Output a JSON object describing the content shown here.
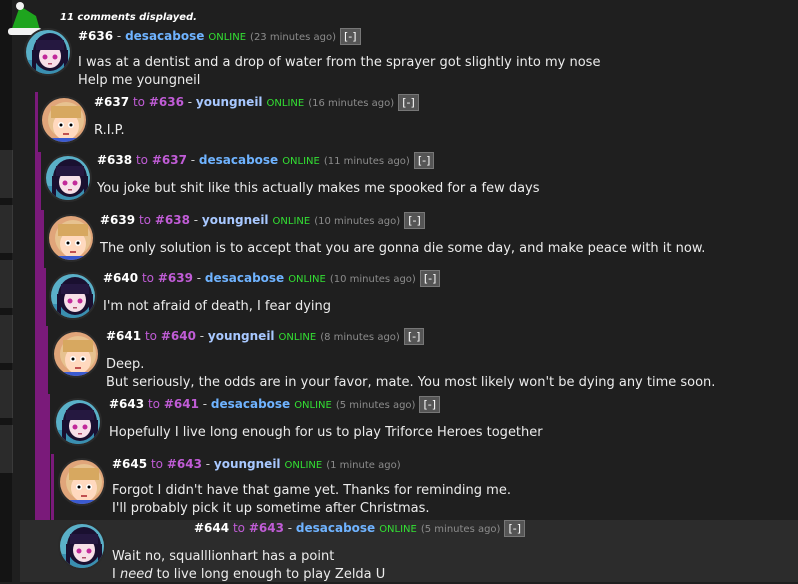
{
  "header": {
    "comments_displayed": "11 comments displayed."
  },
  "colors": {
    "thread_line": "#7a1a7a",
    "online": "#33e033",
    "reply_link": "#c05cd6",
    "desacabose": "#6fb3ff",
    "youngneil": "#a8c8ff"
  },
  "comments": [
    {
      "id": "#636",
      "reply_to": "",
      "user": "desacabose",
      "status": "ONLINE",
      "time": "(23 minutes ago)",
      "collapse": "[-]",
      "lines": [
        "I was at a dentist and a drop of water from the sprayer got slightly into my nose",
        "Help me youngneil"
      ]
    },
    {
      "id": "#637",
      "reply_word": "to",
      "reply_to": "#636",
      "user": "youngneil",
      "status": "ONLINE",
      "time": "(16 minutes ago)",
      "collapse": "[-]",
      "lines": [
        "R.I.P."
      ]
    },
    {
      "id": "#638",
      "reply_word": "to",
      "reply_to": "#637",
      "user": "desacabose",
      "status": "ONLINE",
      "time": "(11 minutes ago)",
      "collapse": "[-]",
      "lines": [
        "You joke but shit like this actually makes me spooked for a few days"
      ]
    },
    {
      "id": "#639",
      "reply_word": "to",
      "reply_to": "#638",
      "user": "youngneil",
      "status": "ONLINE",
      "time": "(10 minutes ago)",
      "collapse": "[-]",
      "lines": [
        "The only solution is to accept that you are gonna die some day, and make peace with it now."
      ]
    },
    {
      "id": "#640",
      "reply_word": "to",
      "reply_to": "#639",
      "user": "desacabose",
      "status": "ONLINE",
      "time": "(10 minutes ago)",
      "collapse": "[-]",
      "lines": [
        "I'm not afraid of death, I fear dying"
      ]
    },
    {
      "id": "#641",
      "reply_word": "to",
      "reply_to": "#640",
      "user": "youngneil",
      "status": "ONLINE",
      "time": "(8 minutes ago)",
      "collapse": "[-]",
      "lines": [
        "Deep.",
        "But seriously, the odds are in your favor, mate. You most likely won't be dying any time soon."
      ]
    },
    {
      "id": "#643",
      "reply_word": "to",
      "reply_to": "#641",
      "user": "desacabose",
      "status": "ONLINE",
      "time": "(5 minutes ago)",
      "collapse": "[-]",
      "lines": [
        "Hopefully I live long enough for us to play Triforce Heroes together"
      ]
    },
    {
      "id": "#645",
      "reply_word": "to",
      "reply_to": "#643",
      "user": "youngneil",
      "status": "ONLINE",
      "time": "(1 minute ago)",
      "collapse": "",
      "lines": [
        "Forgot I didn't have that game yet. Thanks for reminding me.",
        "I'll probably pick it up sometime after Christmas."
      ]
    },
    {
      "id": "#644",
      "reply_word": "to",
      "reply_to": "#643",
      "user": "desacabose",
      "status": "ONLINE",
      "time": "(5 minutes ago)",
      "collapse": "[-]",
      "lines": [
        "Wait no, squalllionhart has a point"
      ],
      "last_line": {
        "prefix": "I ",
        "emphasis": "need",
        "suffix": " to live long enough to play Zelda U"
      }
    }
  ]
}
